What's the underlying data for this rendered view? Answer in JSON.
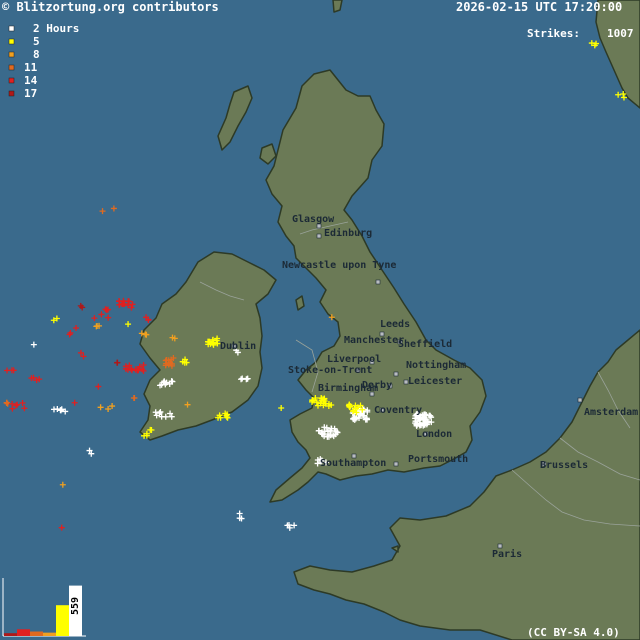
{
  "header": {
    "credit": "© Blitzortung.org contributors",
    "timestamp": "2026-02-15 UTC 17:20:00",
    "strikes_label": "Strikes:",
    "strikes_count": "1007",
    "license": "(CC BY-SA 4.0)"
  },
  "colors": {
    "sea": "#3a6a8c",
    "land": "#6b7a56",
    "coast": "#2d3a26",
    "border": "#9aa39a"
  },
  "legend": {
    "items": [
      {
        "label": "2 Hours",
        "color": "#ffffff"
      },
      {
        "label": "5",
        "color": "#ffff00"
      },
      {
        "label": "8",
        "color": "#f0a020"
      },
      {
        "label": "11",
        "color": "#e06a20"
      },
      {
        "label": "14",
        "color": "#e02020"
      },
      {
        "label": "17",
        "color": "#b01818"
      }
    ]
  },
  "histogram": {
    "bar_values": [
      0.05,
      0.12,
      0.08,
      0.06,
      0.55,
      0.9
    ],
    "bar_colors": [
      "#b01818",
      "#e02020",
      "#e06a20",
      "#f0a020",
      "#ffff00",
      "#ffffff"
    ],
    "peak_label": "559"
  },
  "cities": [
    {
      "name": "Glasgow"
    },
    {
      "name": "Edinburg"
    },
    {
      "name": "Newcastle upon Tyne"
    },
    {
      "name": "Leeds"
    },
    {
      "name": "Manchester"
    },
    {
      "name": "Sheffield"
    },
    {
      "name": "Liverpool"
    },
    {
      "name": "Stoke-on-Trent"
    },
    {
      "name": "Nottingham"
    },
    {
      "name": "Derby"
    },
    {
      "name": "Leicester"
    },
    {
      "name": "Birmingham"
    },
    {
      "name": "Coventry"
    },
    {
      "name": "London"
    },
    {
      "name": "Southampton"
    },
    {
      "name": "Portsmouth"
    },
    {
      "name": "Dublin"
    },
    {
      "name": "Amsterdam"
    },
    {
      "name": "Brussels"
    },
    {
      "name": "Paris"
    }
  ]
}
